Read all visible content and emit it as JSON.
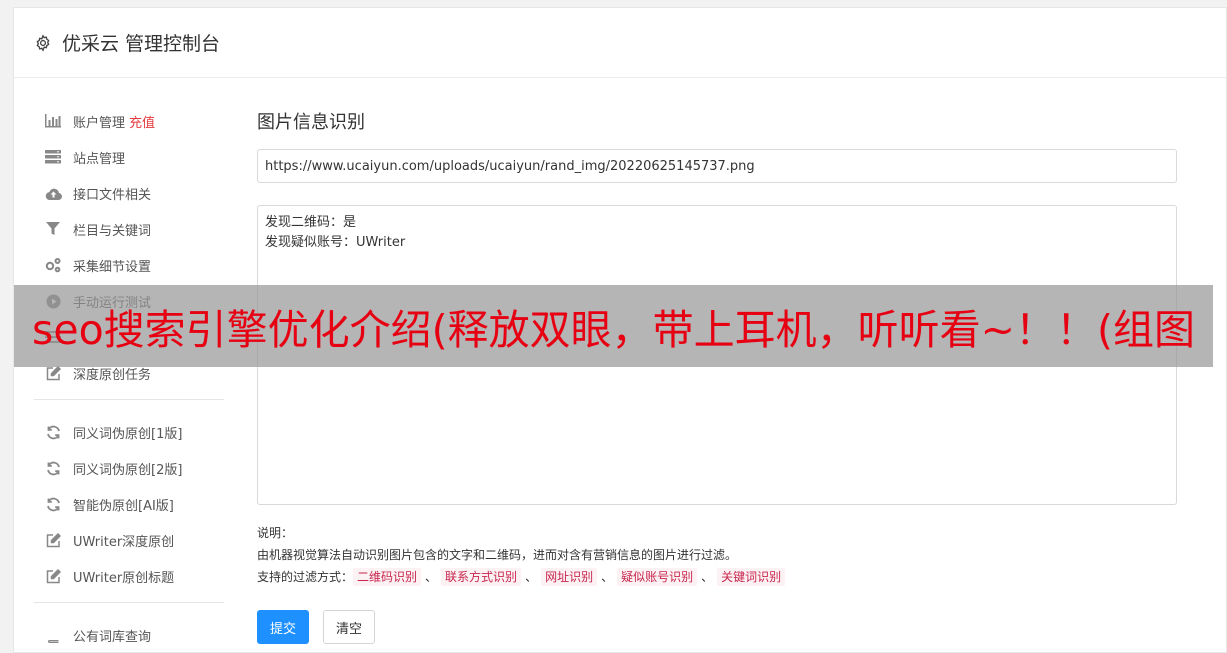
{
  "header": {
    "title": "优采云 管理控制台",
    "icon": "gear-icon"
  },
  "sidebar": {
    "group1": [
      {
        "label": "账户管理",
        "badge": "充值",
        "icon": "bar-chart-icon"
      },
      {
        "label": "站点管理",
        "icon": "server-icon"
      },
      {
        "label": "接口文件相关",
        "icon": "cloud-upload-icon"
      },
      {
        "label": "栏目与关键词",
        "icon": "filter-icon"
      },
      {
        "label": "采集细节设置",
        "icon": "gears-icon"
      },
      {
        "label": "手动运行测试",
        "icon": "play-icon"
      },
      {
        "label": "",
        "icon": "list-icon"
      },
      {
        "label": "深度原创任务",
        "icon": "edit-icon"
      }
    ],
    "group2": [
      {
        "label": "同义词伪原创[1版]",
        "icon": "refresh-icon"
      },
      {
        "label": "同义词伪原创[2版]",
        "icon": "refresh-icon"
      },
      {
        "label": "智能伪原创[AI版]",
        "icon": "refresh-icon"
      },
      {
        "label": "UWriter深度原创",
        "icon": "edit-icon"
      },
      {
        "label": "UWriter原创标题",
        "icon": "edit-icon"
      }
    ],
    "group3": [
      {
        "label": "公有词库查询",
        "icon": "book-icon"
      }
    ]
  },
  "main": {
    "title": "图片信息识别",
    "url_value": "https://www.ucaiyun.com/uploads/ucaiyun/rand_img/20220625145737.png",
    "result": "发现二维码：是\n发现疑似账号：UWriter",
    "notes_title": "说明：",
    "notes_desc": "由机器视觉算法自动识别图片包含的文字和二维码，进而对含有营销信息的图片进行过滤。",
    "filter_label": "支持的过滤方式：",
    "filter_tags": [
      "二维码识别",
      "联系方式识别",
      "网址识别",
      "疑似账号识别",
      "关键词识别"
    ],
    "separator": "、",
    "submit_label": "提交",
    "clear_label": "清空"
  },
  "banner": {
    "text": "seo搜索引擎优化介绍(释放双眼，带上耳机，听听看~！！(组图"
  },
  "colors": {
    "accent": "#1e90ff",
    "recharge": "#e4393c",
    "banner_text": "#e60012",
    "tag_text": "#c7254e"
  }
}
